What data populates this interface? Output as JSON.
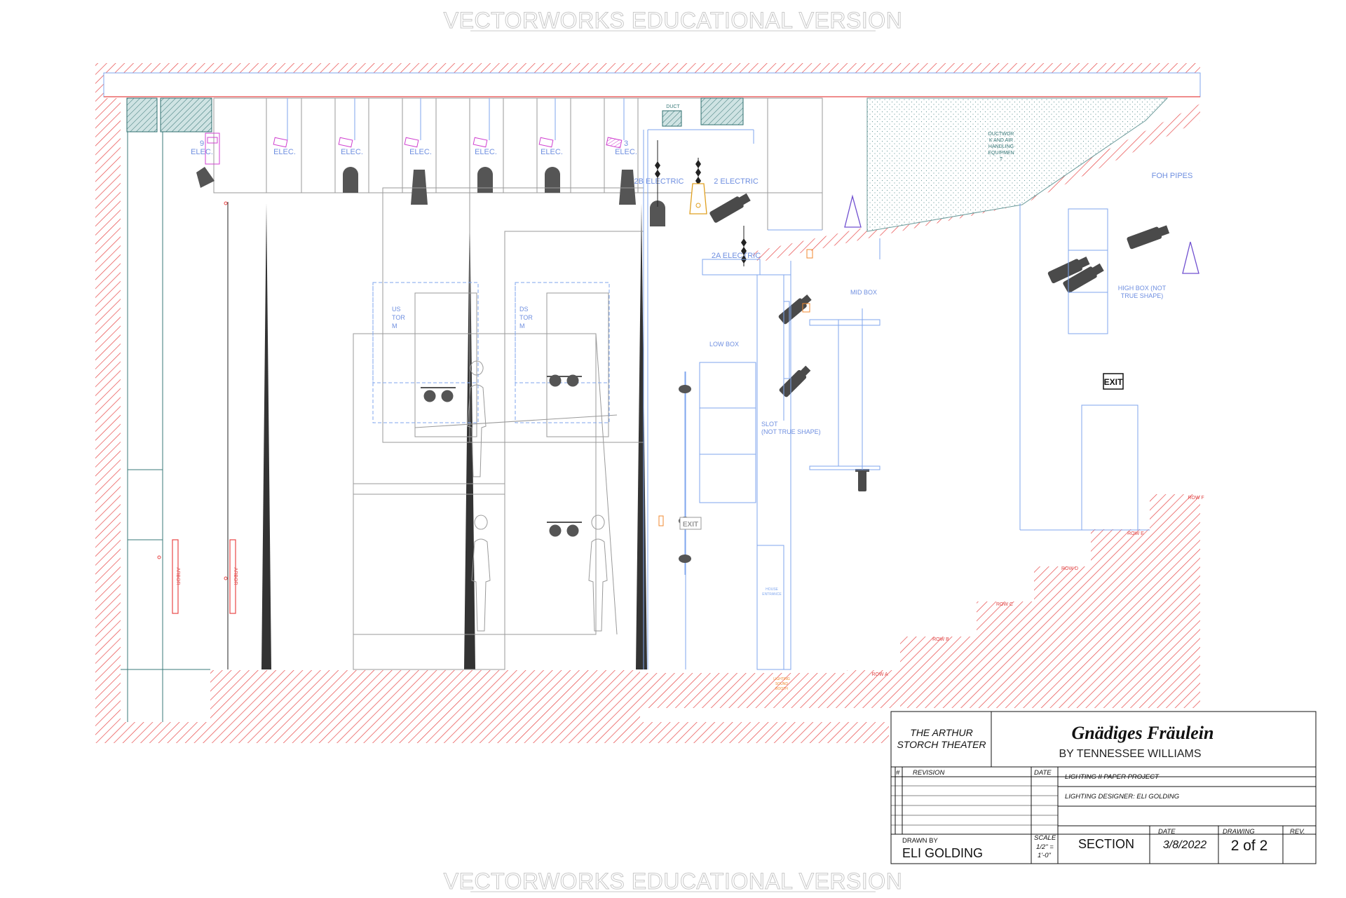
{
  "watermark": "VECTORWORKS EDUCATIONAL VERSION",
  "colors": {
    "hatch": "#e84848",
    "plan_blue": "#7fa6ee",
    "label_blue": "#6f8fe0",
    "teal": "#3a7a7a",
    "fixture": "#555555",
    "magenta": "#d040d0",
    "orange": "#f08a30",
    "line_gray": "#9a9a9a"
  },
  "labels": {
    "elec_9": "9",
    "elec": "ELEC.",
    "elec_3": "3",
    "electric_2b": "2B ELECTRIC",
    "electric_2": "2 ELECTRIC",
    "electric_2a": "2A ELECTRIC",
    "ductwork": [
      "DUCTWOR",
      "K AND AIR",
      "HANDLING",
      "EQUIPMEN",
      "T"
    ],
    "foh_pipes": "FOH PIPES",
    "high_box": [
      "HIGH BOX (NOT",
      "TRUE SHAPE)"
    ],
    "mid_box": "MID BOX",
    "low_box": "LOW BOX",
    "slot": [
      "SLOT",
      "(NOT TRUE SHAPE)"
    ],
    "us_torm": [
      "US",
      "TOR",
      "M"
    ],
    "ds_torm": [
      "DS",
      "TOR",
      "M"
    ],
    "exit": "EXIT",
    "arbor": "ARBOR",
    "rows": [
      "ROW A",
      "ROW B",
      "ROW C",
      "ROW D",
      "ROW E",
      "ROW F"
    ],
    "lighting_sound_booth": [
      "LIGHTING",
      "SOUND",
      "BOOTH"
    ],
    "house_entrance": [
      "HOUSE",
      "ENTRANCE"
    ]
  },
  "title_block": {
    "theater": [
      "THE ARTHUR",
      "STORCH THEATER"
    ],
    "show_title": "Gnädiges Fräulein",
    "author": "BY TENNESSEE WILLIAMS",
    "hash": "#",
    "revision": "REVISION",
    "date_header": "DATE",
    "project": "LIGHTING II PAPER PROJECT",
    "designer": "LIGHTING DESIGNER:  ELI GOLDING",
    "drawn_by_label": "DRAWN BY",
    "drawn_by": "ELI GOLDING",
    "scale_label": "SCALE",
    "scale": [
      "1/2\" =",
      "1'-0\""
    ],
    "sheet_type": "SECTION",
    "date_label": "DATE",
    "date": "3/8/2022",
    "drawing_label": "DRAWING",
    "drawing": "2 of 2",
    "rev_label": "REV."
  }
}
